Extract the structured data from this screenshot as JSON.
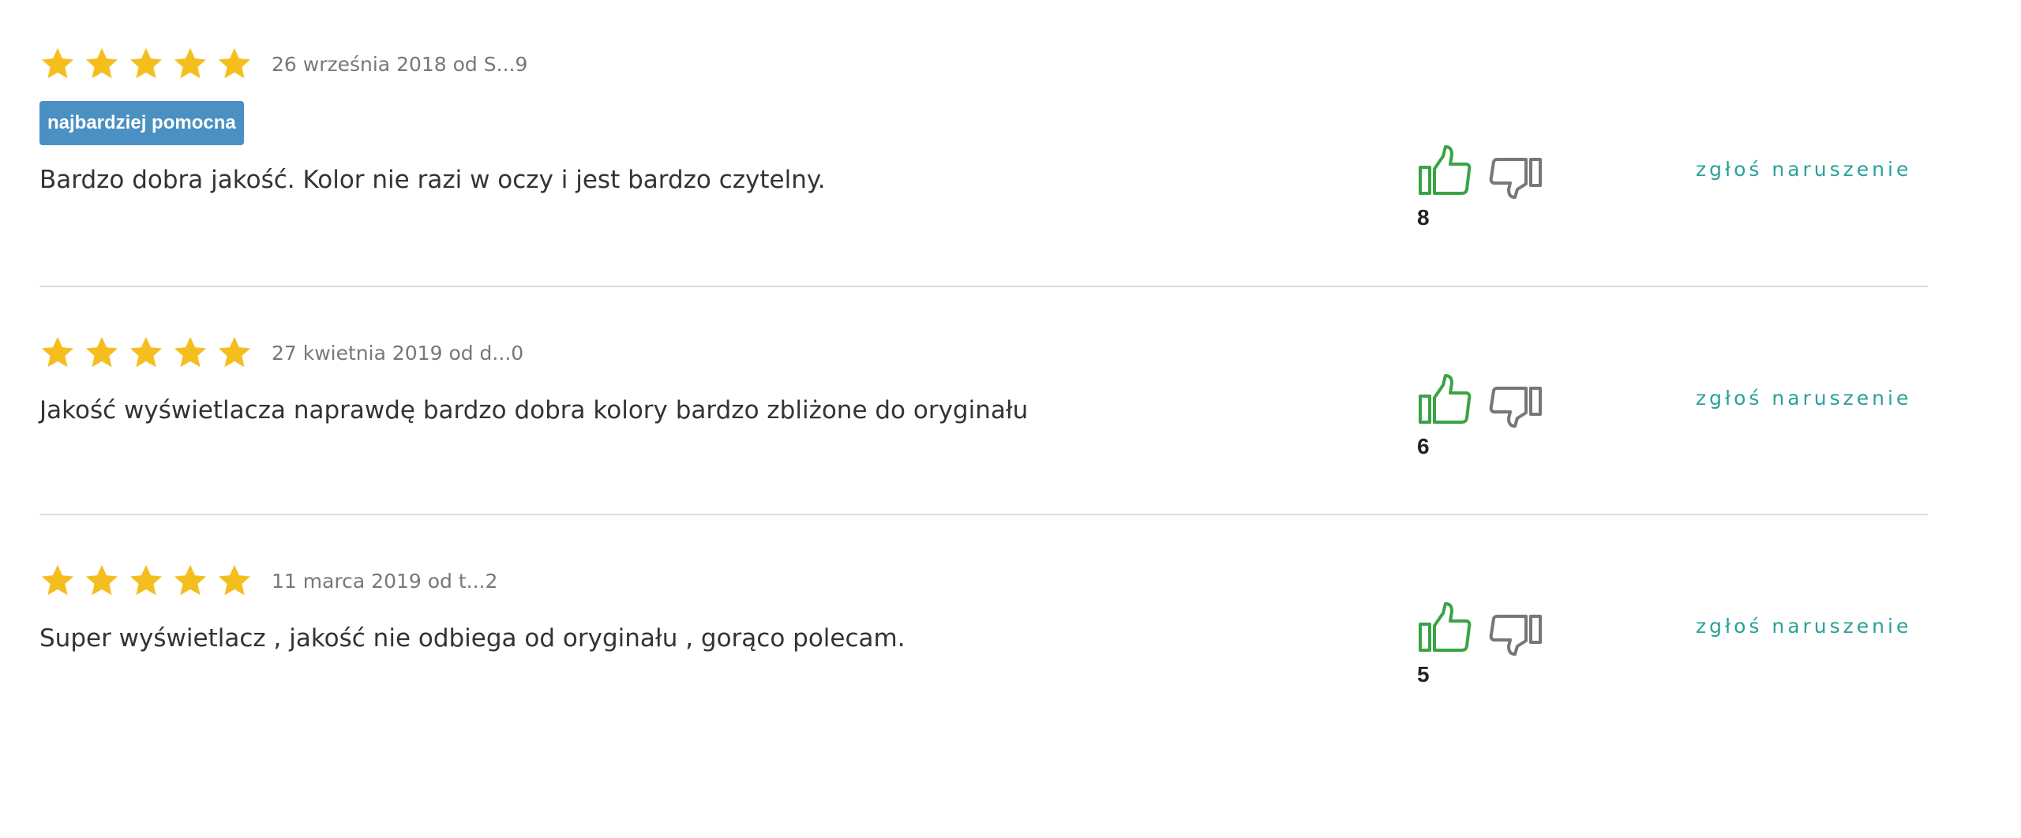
{
  "colors": {
    "star": "#f5be1f",
    "badge_bg": "#4a90c2",
    "thumb_up": "#3aa345",
    "thumb_down": "#777777",
    "report_link": "#2aa198",
    "divider": "#dcdcdc"
  },
  "icons": {
    "star": "star-icon",
    "thumb_up": "thumbs-up-icon",
    "thumb_down": "thumbs-down-icon"
  },
  "reviews": [
    {
      "rating": 5,
      "meta": "26 września 2018 od S...9",
      "badge": "najbardziej pomocna",
      "text": "Bardzo dobra jakość. Kolor nie razi w oczy i jest bardzo czytelny.",
      "helpful_count": "8",
      "report_label": "zgłoś naruszenie"
    },
    {
      "rating": 5,
      "meta": "27 kwietnia 2019 od d...0",
      "text": "Jakość wyświetlacza naprawdę bardzo dobra kolory bardzo zbliżone do oryginału",
      "helpful_count": "6",
      "report_label": "zgłoś naruszenie"
    },
    {
      "rating": 5,
      "meta": "11 marca 2019 od t...2",
      "text": "Super wyświetlacz , jakość nie odbiega od oryginału , gorąco polecam.",
      "helpful_count": "5",
      "report_label": "zgłoś naruszenie"
    }
  ]
}
